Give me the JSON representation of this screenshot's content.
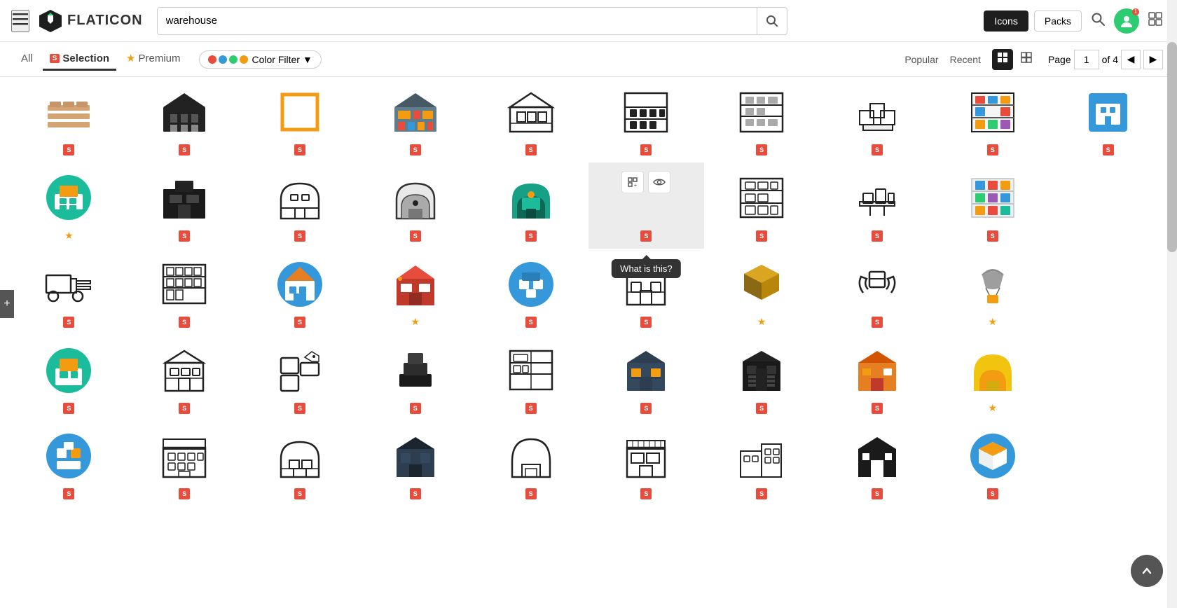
{
  "header": {
    "menu_label": "☰",
    "logo_text": "FLATICON",
    "search_placeholder": "warehouse",
    "search_value": "warehouse",
    "icons_label": "Icons",
    "packs_label": "Packs",
    "search_icon": "🔍",
    "user_icon": "👤",
    "apps_icon": "⊞",
    "notification_count": "1"
  },
  "filter_bar": {
    "all_label": "All",
    "selection_label": "Selection",
    "premium_label": "Premium",
    "color_filter_label": "Color Filter",
    "popular_label": "Popular",
    "recent_label": "Recent",
    "page_label": "Page",
    "page_value": "1",
    "of_label": "of 4"
  },
  "tooltip": {
    "text": "What is this?"
  },
  "icons": [
    {
      "type": "colored",
      "bg": "#f5deb3",
      "badge": "s",
      "row": 0
    },
    {
      "type": "outline",
      "badge": "s",
      "row": 0
    },
    {
      "type": "colored_orange",
      "badge": "s",
      "row": 0
    },
    {
      "type": "colored2",
      "badge": "s",
      "row": 0
    },
    {
      "type": "outline2",
      "badge": "s",
      "row": 0
    },
    {
      "type": "outline3",
      "badge": "s",
      "row": 0
    },
    {
      "type": "outline4",
      "badge": "s",
      "row": 0
    },
    {
      "type": "outline5",
      "badge": "s",
      "row": 0
    },
    {
      "type": "outline6",
      "badge": "s",
      "row": 0
    },
    {
      "type": "colored3",
      "badge": "s",
      "row": 0
    }
  ],
  "add_btn": "+",
  "back_to_top": "▲"
}
